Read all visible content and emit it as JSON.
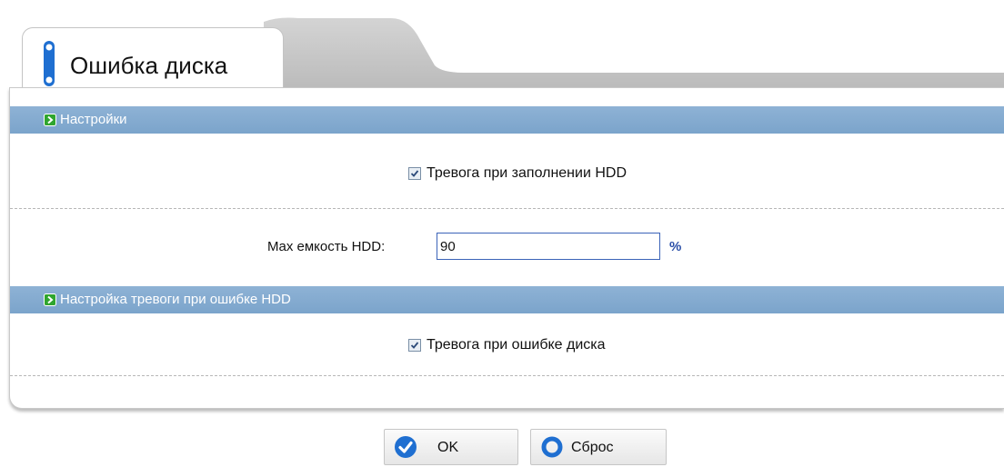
{
  "tab": {
    "title": "Ошибка диска"
  },
  "sections": [
    {
      "title": "Настройки"
    },
    {
      "title": "Настройка тревоги при ошибке HDD"
    }
  ],
  "hdd_full_alarm": {
    "label": "Тревога при заполнении HDD",
    "checked": true
  },
  "max_capacity": {
    "label": "Max емкость HDD:",
    "value": "90",
    "unit": "%"
  },
  "hdd_error_alarm": {
    "label": "Тревога при ошибке диска",
    "checked": true
  },
  "buttons": {
    "ok": "OK",
    "reset": "Сброс"
  },
  "colors": {
    "section_bar": "#7ba4cb",
    "accent": "#1f6fd1",
    "arrow_green": "#2fa52f"
  }
}
